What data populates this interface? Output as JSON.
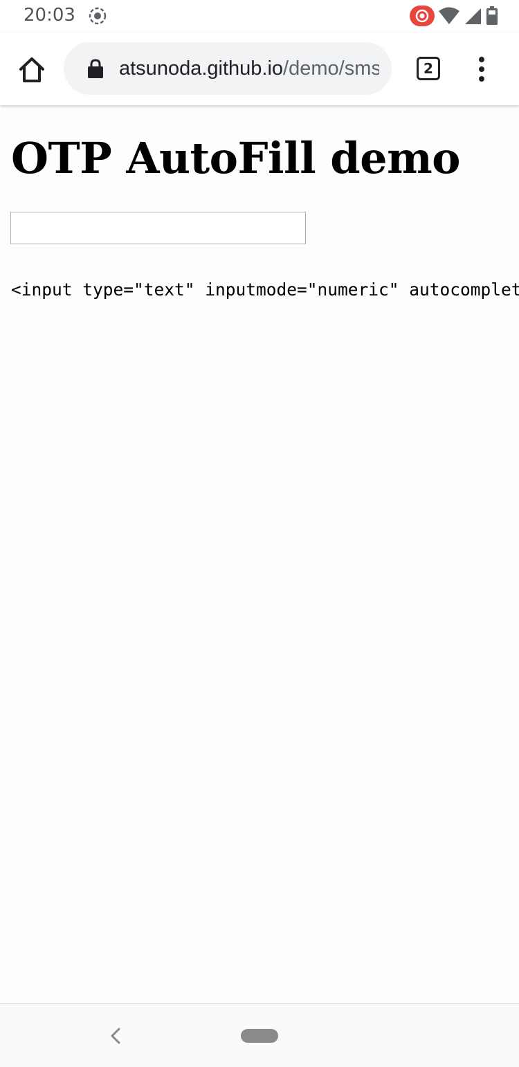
{
  "status_bar": {
    "time": "20:03"
  },
  "browser": {
    "url_host": "atsunoda.github.io",
    "url_path": "/demo/sms-otp",
    "tab_count": "2"
  },
  "page": {
    "title": "OTP AutoFill demo",
    "otp_input_value": "",
    "code_sample": "<input type=\"text\" inputmode=\"numeric\" autocomplete=\"one-time-code\">"
  },
  "colors": {
    "recording_badge": "#e8453c",
    "url_bar_bg": "#f1f3f4",
    "icon_dark": "#202124"
  }
}
